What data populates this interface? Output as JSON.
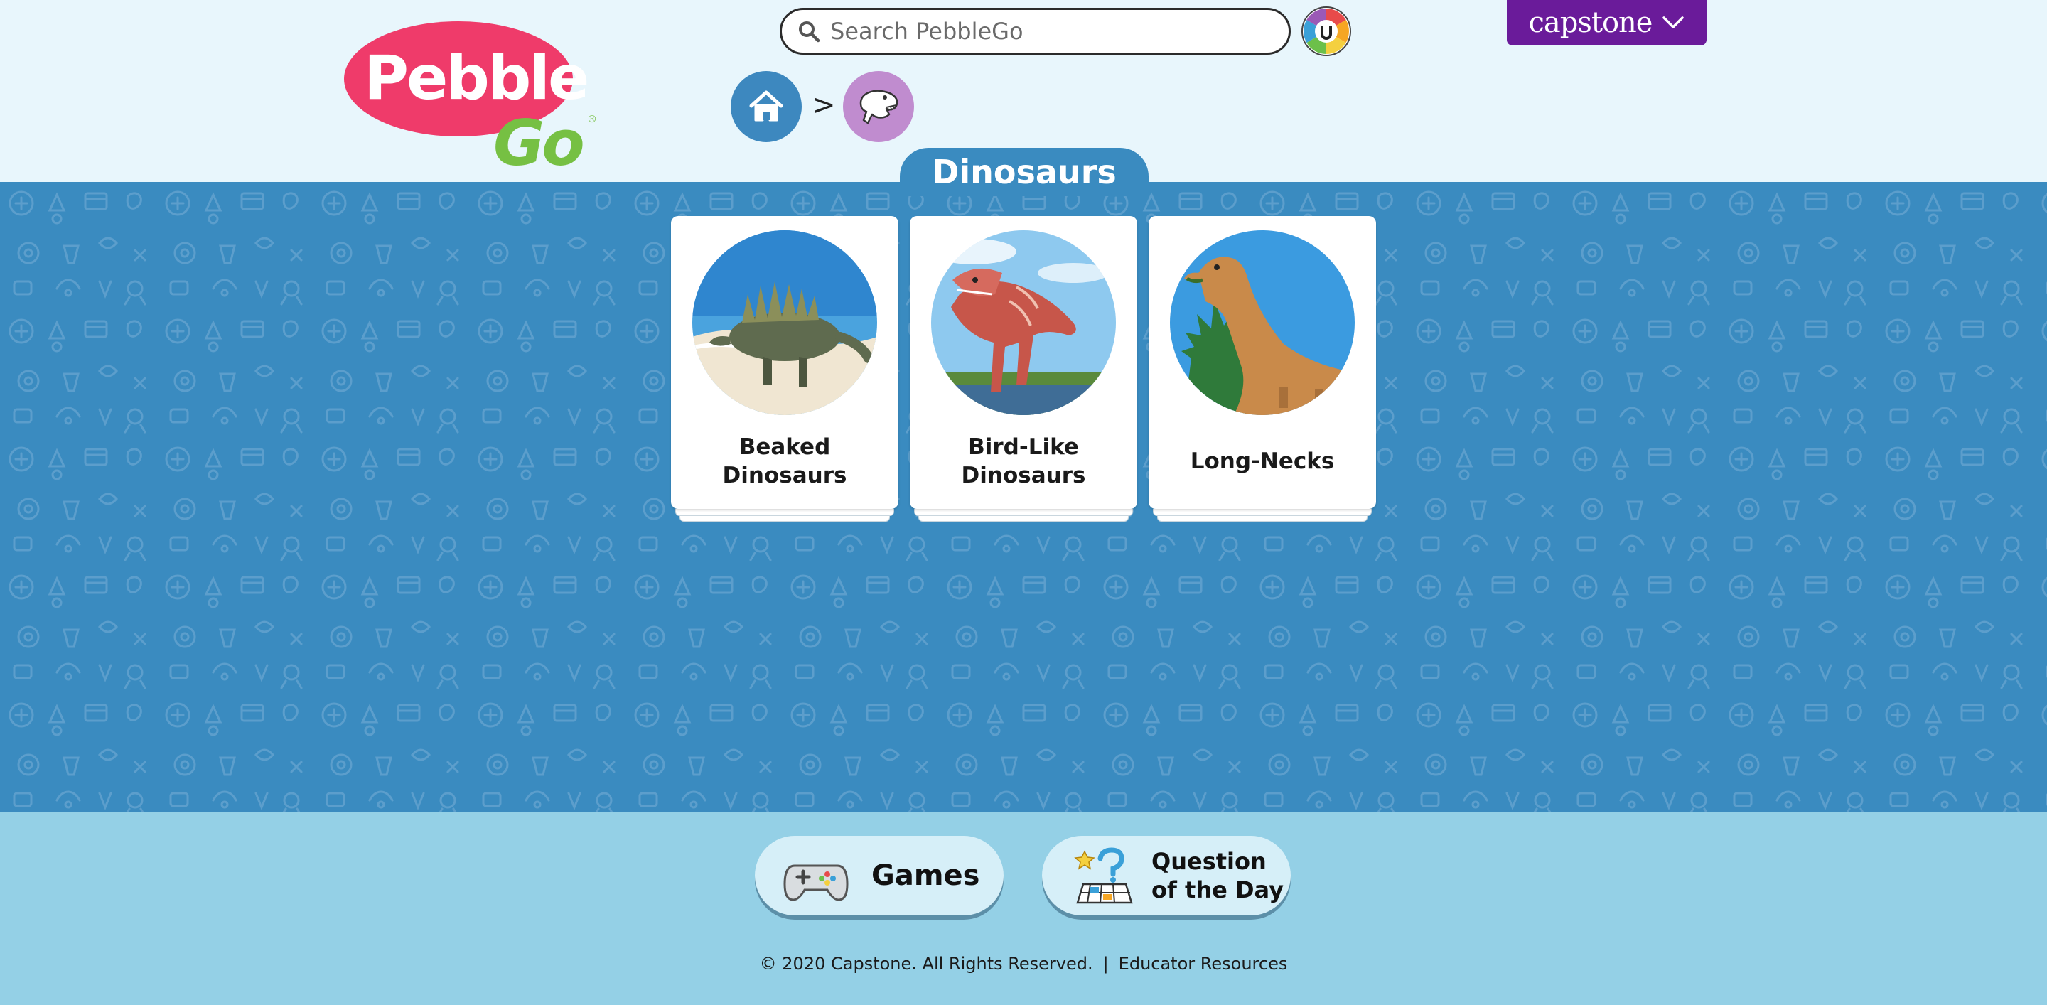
{
  "header": {
    "logo": {
      "pebble": "Pebble",
      "go": "Go",
      "reg": "®"
    },
    "search": {
      "placeholder": "Search PebbleGo"
    },
    "publisher_menu": {
      "label": "capstone"
    },
    "breadcrumb": [
      {
        "icon": "home-icon"
      },
      {
        "separator": ">"
      },
      {
        "icon": "dinosaur-icon"
      }
    ]
  },
  "main": {
    "title": "Dinosaurs",
    "cards": [
      {
        "label": "Beaked Dinosaurs"
      },
      {
        "label": "Bird-Like Dinosaurs"
      },
      {
        "label": "Long-Necks"
      }
    ]
  },
  "footer": {
    "games": "Games",
    "question": "Question of the Day",
    "copyright": "© 2020 Capstone. All Rights Reserved.",
    "separator": "|",
    "educator": "Educator Resources"
  },
  "colors": {
    "header_bg": "#e8f6fc",
    "main_bg": "#3a8bc0",
    "footer_bg": "#94d0e6",
    "logo_pink": "#ef3b6a",
    "logo_green": "#76c043",
    "capstone_purple": "#6a1b9a",
    "home_circle": "#3d88bf",
    "dino_circle": "#c08ccf"
  }
}
